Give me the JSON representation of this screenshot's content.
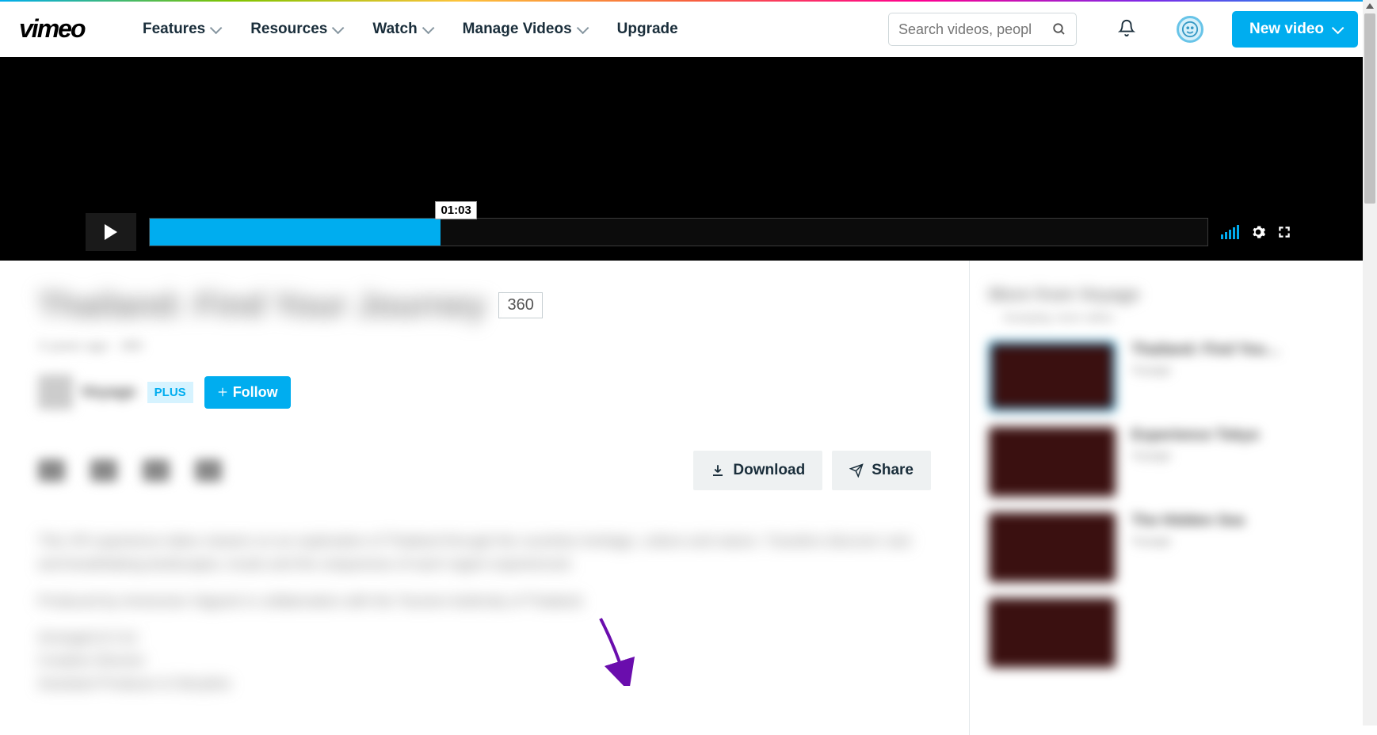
{
  "brand": "vimeo",
  "nav": {
    "features": "Features",
    "resources": "Resources",
    "watch": "Watch",
    "manage_videos": "Manage Videos",
    "upgrade": "Upgrade"
  },
  "search": {
    "placeholder": "Search videos, peopl"
  },
  "new_video": "New video",
  "player": {
    "time_tip": "01:03"
  },
  "video": {
    "title": "Thailand: Find Your Journey",
    "badge": "360",
    "meta": "3 years ago · 360",
    "plus_label": "PLUS",
    "follow_label": "Follow"
  },
  "actions": {
    "download": "Download",
    "share": "Share"
  },
  "description": {
    "p1": "This VR experience takes viewers on an exploration of Thailand through the countries heritage, culture and nature. Travelers discover vast and breathtaking landscapes, locals and the uniqueness of each region experienced.",
    "p2": "Produced by Immersive Vagrant in collaboration with the Tourism Authority of Thailand.",
    "p3": "Arranged & Cut\nCreative Director\nAssistant Producer & Storyline"
  },
  "sidebar": {
    "title": "More from Voyage",
    "sub": "Autoplay next video",
    "items": [
      {
        "t": "Thailand: Find You…",
        "a": "Voyage"
      },
      {
        "t": "Experience Tokyo",
        "a": "Voyage"
      },
      {
        "t": "The Hidden Sea",
        "a": "Voyage"
      },
      {
        "t": "",
        "a": ""
      }
    ]
  }
}
